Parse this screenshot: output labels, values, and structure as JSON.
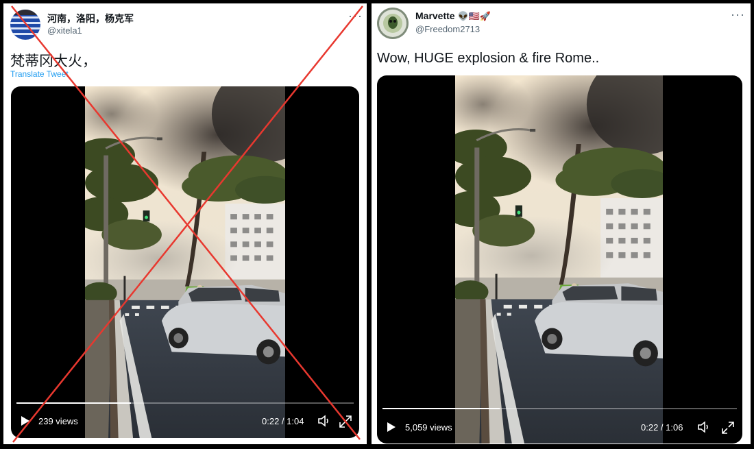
{
  "left_tweet": {
    "display_name": "河南，洛阳，杨克军",
    "handle": "@xitela1",
    "text": "梵蒂冈大火，",
    "translate_label": "Translate Tweet",
    "more_icon": "ellipsis-icon",
    "video": {
      "views": "239 views",
      "time": "0:22 / 1:04",
      "progress": 0.34
    },
    "overlay_color": "#e8382f"
  },
  "right_tweet": {
    "display_name": "Marvette",
    "name_emojis": "👽🇺🇸🚀",
    "handle": "@Freedom2713",
    "text": "Wow, HUGE explosion & fire Rome..",
    "more_icon": "ellipsis-icon",
    "video": {
      "views": "5,059 views",
      "time": "0:22 / 1:06",
      "progress": 0.33
    }
  },
  "colors": {
    "link": "#1d9bf0",
    "text": "#0f1419",
    "muted": "#536471"
  }
}
